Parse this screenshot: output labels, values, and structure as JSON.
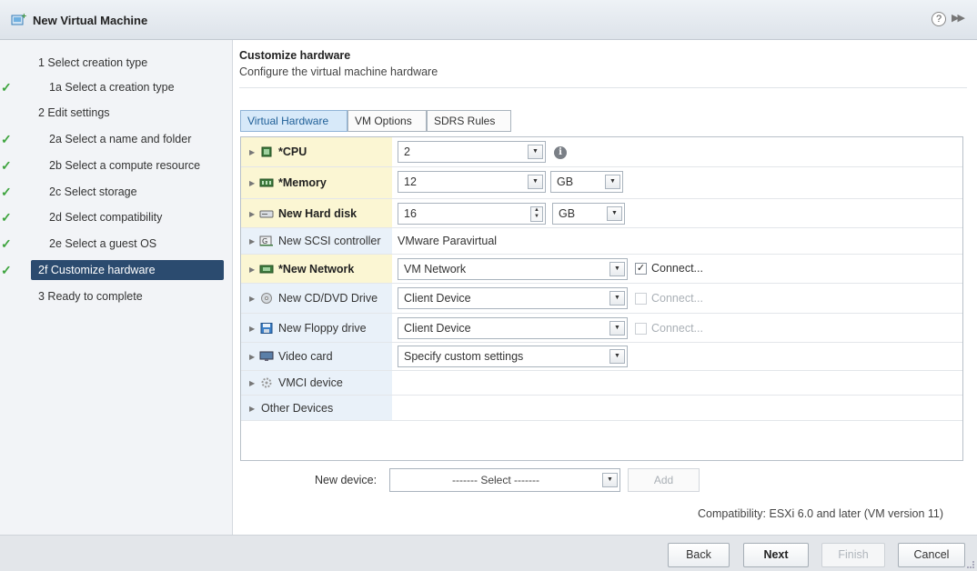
{
  "window": {
    "title": "New Virtual Machine",
    "help_glyph": "?",
    "expand_glyph": "▶▶"
  },
  "steps": [
    {
      "label": "1 Select creation type",
      "type": "head",
      "checked": false
    },
    {
      "label": "1a Select a creation type",
      "type": "sub",
      "checked": true
    },
    {
      "label": "2 Edit settings",
      "type": "head",
      "checked": false
    },
    {
      "label": "2a Select a name and folder",
      "type": "sub",
      "checked": true
    },
    {
      "label": "2b Select a compute resource",
      "type": "sub",
      "checked": true
    },
    {
      "label": "2c Select storage",
      "type": "sub",
      "checked": true
    },
    {
      "label": "2d Select compatibility",
      "type": "sub",
      "checked": true
    },
    {
      "label": "2e Select a guest OS",
      "type": "sub",
      "checked": true
    },
    {
      "label": "2f Customize hardware",
      "type": "sub",
      "checked": true,
      "active": true
    },
    {
      "label": "3 Ready to complete",
      "type": "head",
      "checked": false
    }
  ],
  "main": {
    "heading": "Customize hardware",
    "subheading": "Configure the virtual machine hardware"
  },
  "tabs": [
    "Virtual Hardware",
    "VM Options",
    "SDRS Rules"
  ],
  "devices": {
    "cpu": {
      "name": "*CPU",
      "value": "2"
    },
    "memory": {
      "name": "*Memory",
      "value": "12",
      "unit": "GB"
    },
    "hard_disk": {
      "name": "New Hard disk",
      "value": "16",
      "unit": "GB"
    },
    "scsi": {
      "name": "New SCSI controller",
      "value": "VMware Paravirtual"
    },
    "network": {
      "name": "*New Network",
      "value": "VM Network",
      "connect": "Connect..."
    },
    "cddvd": {
      "name": "New CD/DVD Drive",
      "value": "Client Device",
      "connect": "Connect..."
    },
    "floppy": {
      "name": "New Floppy drive",
      "value": "Client Device",
      "connect": "Connect..."
    },
    "video": {
      "name": "Video card",
      "value": "Specify custom settings"
    },
    "vmci": {
      "name": "VMCI device"
    },
    "other": {
      "name": "Other Devices"
    }
  },
  "new_device": {
    "label": "New device:",
    "value": "------- Select -------",
    "add_label": "Add"
  },
  "compatibility": "Compatibility: ESXi 6.0 and later (VM version 11)",
  "footer": {
    "back": "Back",
    "next": "Next",
    "finish": "Finish",
    "cancel": "Cancel"
  },
  "colors": {
    "accent": "#2b4b6f",
    "check": "#3ea43e",
    "required_row": "#fbf6d3",
    "label_col": "#e9f1f9"
  }
}
